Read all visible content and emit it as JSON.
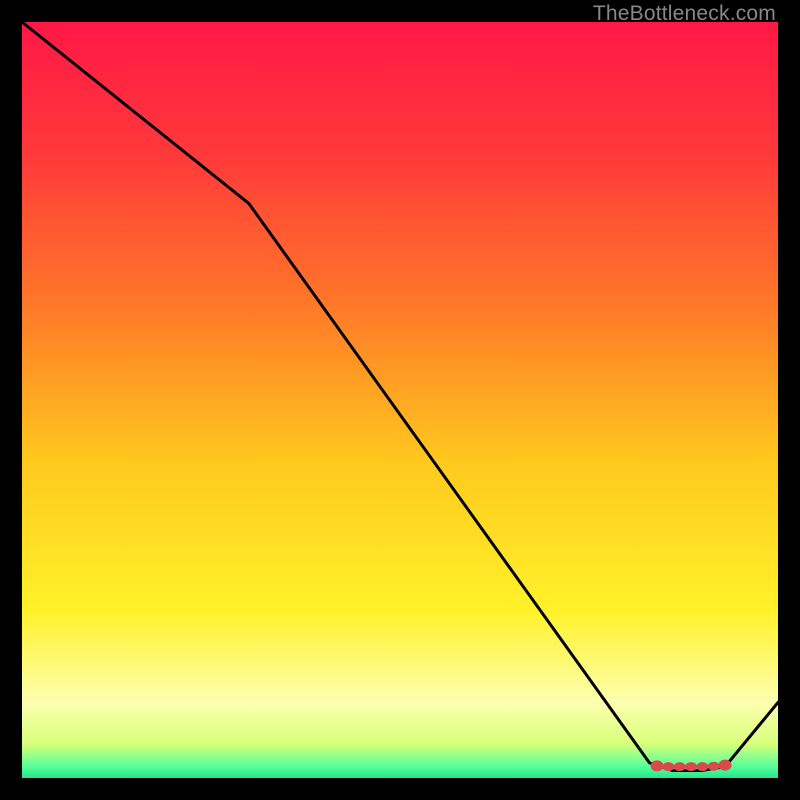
{
  "watermark": "TheBottleneck.com",
  "chart_data": {
    "type": "line",
    "title": "",
    "xlabel": "",
    "ylabel": "",
    "xlim": [
      0,
      100
    ],
    "ylim": [
      0,
      100
    ],
    "grid": false,
    "series": [
      {
        "name": "curve",
        "x": [
          0,
          30,
          83,
          86,
          90,
          93,
          100
        ],
        "values": [
          100,
          76,
          2,
          1,
          1,
          1.5,
          10
        ]
      }
    ],
    "markers": {
      "name": "cluster",
      "color": "#d94a4a",
      "x": [
        84.0,
        85.5,
        87.0,
        88.5,
        90.0,
        91.5,
        93.0
      ],
      "values": [
        1.6,
        1.5,
        1.5,
        1.5,
        1.5,
        1.55,
        1.7
      ]
    },
    "background_gradient": {
      "stops": [
        {
          "offset": 0.0,
          "color": "#ff1846"
        },
        {
          "offset": 0.18,
          "color": "#ff3a3a"
        },
        {
          "offset": 0.38,
          "color": "#ff7a28"
        },
        {
          "offset": 0.58,
          "color": "#ffc81e"
        },
        {
          "offset": 0.78,
          "color": "#fff22a"
        },
        {
          "offset": 0.9,
          "color": "#fdffb0"
        },
        {
          "offset": 0.955,
          "color": "#d8ff7a"
        },
        {
          "offset": 0.985,
          "color": "#57ff9a"
        },
        {
          "offset": 1.0,
          "color": "#23e68e"
        }
      ]
    }
  }
}
